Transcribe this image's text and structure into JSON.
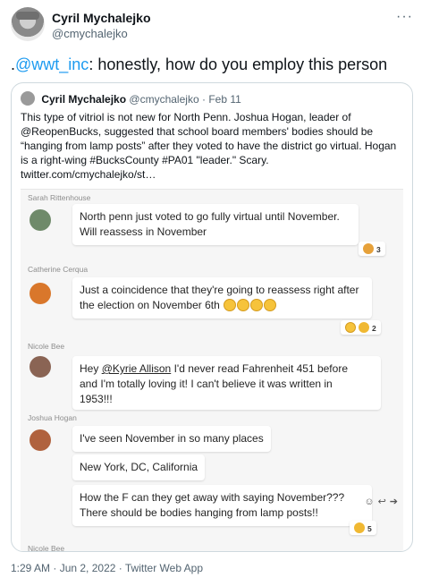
{
  "tweet": {
    "author_name": "Cyril Mychalejko",
    "author_handle": "@cmychalejko",
    "more_icon": "more-horizontal-icon",
    "text_prefix": ".",
    "mention": "@wwt_inc",
    "text_rest": ": honestly, how do you employ this person",
    "timestamp": "1:29 AM · Jun 2, 2022 · Twitter Web App"
  },
  "quote": {
    "author_name": "Cyril Mychalejko",
    "author_handle": "@cmychalejko",
    "separator": "·",
    "date": "Feb 11",
    "text": "This type of vitriol is not new for North Penn. Joshua Hogan, leader of @ReopenBucks, suggested that school board members' bodies should be “hanging from lamp posts” after they voted to have the district go virtual.  Hogan is a right-wing #BucksCounty #PA01 \"leader.\" Scary. twitter.com/cmychalejko/st…"
  },
  "chat": {
    "messages": [
      {
        "sender": "Sarah Rittenhouse",
        "lines": [
          "North penn just voted to go fully virtual until November.",
          "Will reassess in November"
        ],
        "reaction_count": "3"
      },
      {
        "sender": "Catherine Cerqua",
        "lines": [
          "Just a coincidence that they're going to reassess right after",
          "the election on November 6th"
        ],
        "reaction_count": "2"
      },
      {
        "sender": "Nicole Bee",
        "prefix": "Hey ",
        "mention": "@Kyrie Allison",
        "rest": " I'd never read Fahrenheit 451 before",
        "line2": "and I'm totally loving it! I can't believe it was written in",
        "line3": "1953!!!"
      },
      {
        "sender": "Joshua Hogan",
        "bubbles": [
          "I've seen November in so many places",
          "New York, DC, California"
        ],
        "last_lines": [
          "How the F can they get away with saying November???",
          "There should be bodies hanging from lamp posts!!"
        ],
        "reaction_count": "5"
      }
    ],
    "partial_sender": "Nicole Bee"
  }
}
